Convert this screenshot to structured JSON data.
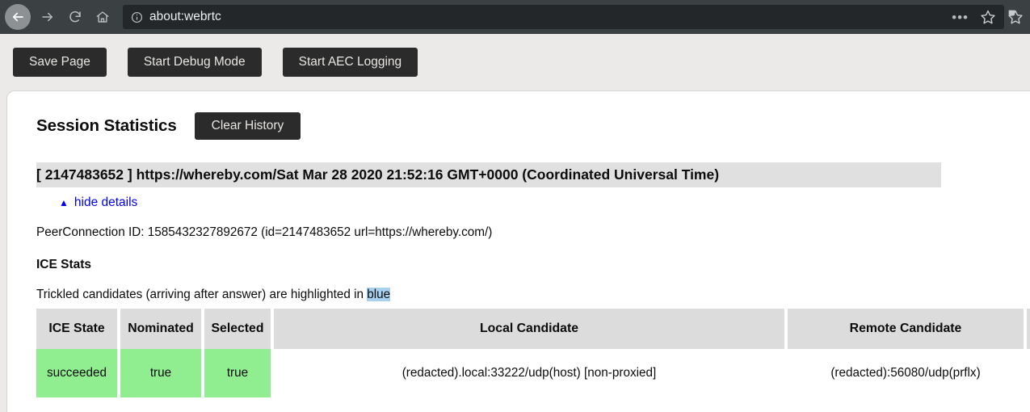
{
  "browser": {
    "url": "about:webrtc",
    "back_icon": "back-arrow-icon",
    "forward_icon": "forward-arrow-icon",
    "reload_icon": "reload-icon",
    "home_icon": "home-icon",
    "info_icon": "page-info-icon",
    "menu_dots": "•••",
    "bookmark_icon": "star-icon",
    "extension_icon": "extension-icon"
  },
  "toolbar": {
    "save_page": "Save Page",
    "start_debug_mode": "Start Debug Mode",
    "start_aec_logging": "Start AEC Logging"
  },
  "session": {
    "title": "Session Statistics",
    "clear_history": "Clear History"
  },
  "connection": {
    "header": "[ 2147483652 ] https://whereby.com/Sat Mar 28 2020 21:52:16 GMT+0000 (Coordinated Universal Time)",
    "hide_details_triangle": "▲",
    "hide_details_label": "hide details",
    "peer_connection_id": "PeerConnection ID: 1585432327892672 (id=2147483652 url=https://whereby.com/)"
  },
  "ice": {
    "heading": "ICE Stats",
    "trickled_prefix": "Trickled candidates (arriving after answer) are highlighted in ",
    "trickled_highlight": "blue",
    "columns": {
      "state": "ICE State",
      "nominated": "Nominated",
      "selected": "Selected",
      "local": "Local Candidate",
      "remote": "Remote Candidate",
      "extra": ""
    },
    "rows": [
      {
        "state": "succeeded",
        "nominated": "true",
        "selected": "true",
        "local": "(redacted).local:33222/udp(host) [non-proxied]",
        "remote": "(redacted):56080/udp(prflx)",
        "extra": ""
      }
    ]
  },
  "colors": {
    "chrome_bg": "#3b4043",
    "urlbar_bg": "#232729",
    "page_bg": "#ebeae8",
    "button_dark": "#2b2b2b",
    "header_gray": "#e0e0e0",
    "th_gray": "#dcdcdc",
    "success_green": "#90ee90",
    "link_blue": "#0000ee",
    "highlight_blue": "#a8d0ef"
  }
}
